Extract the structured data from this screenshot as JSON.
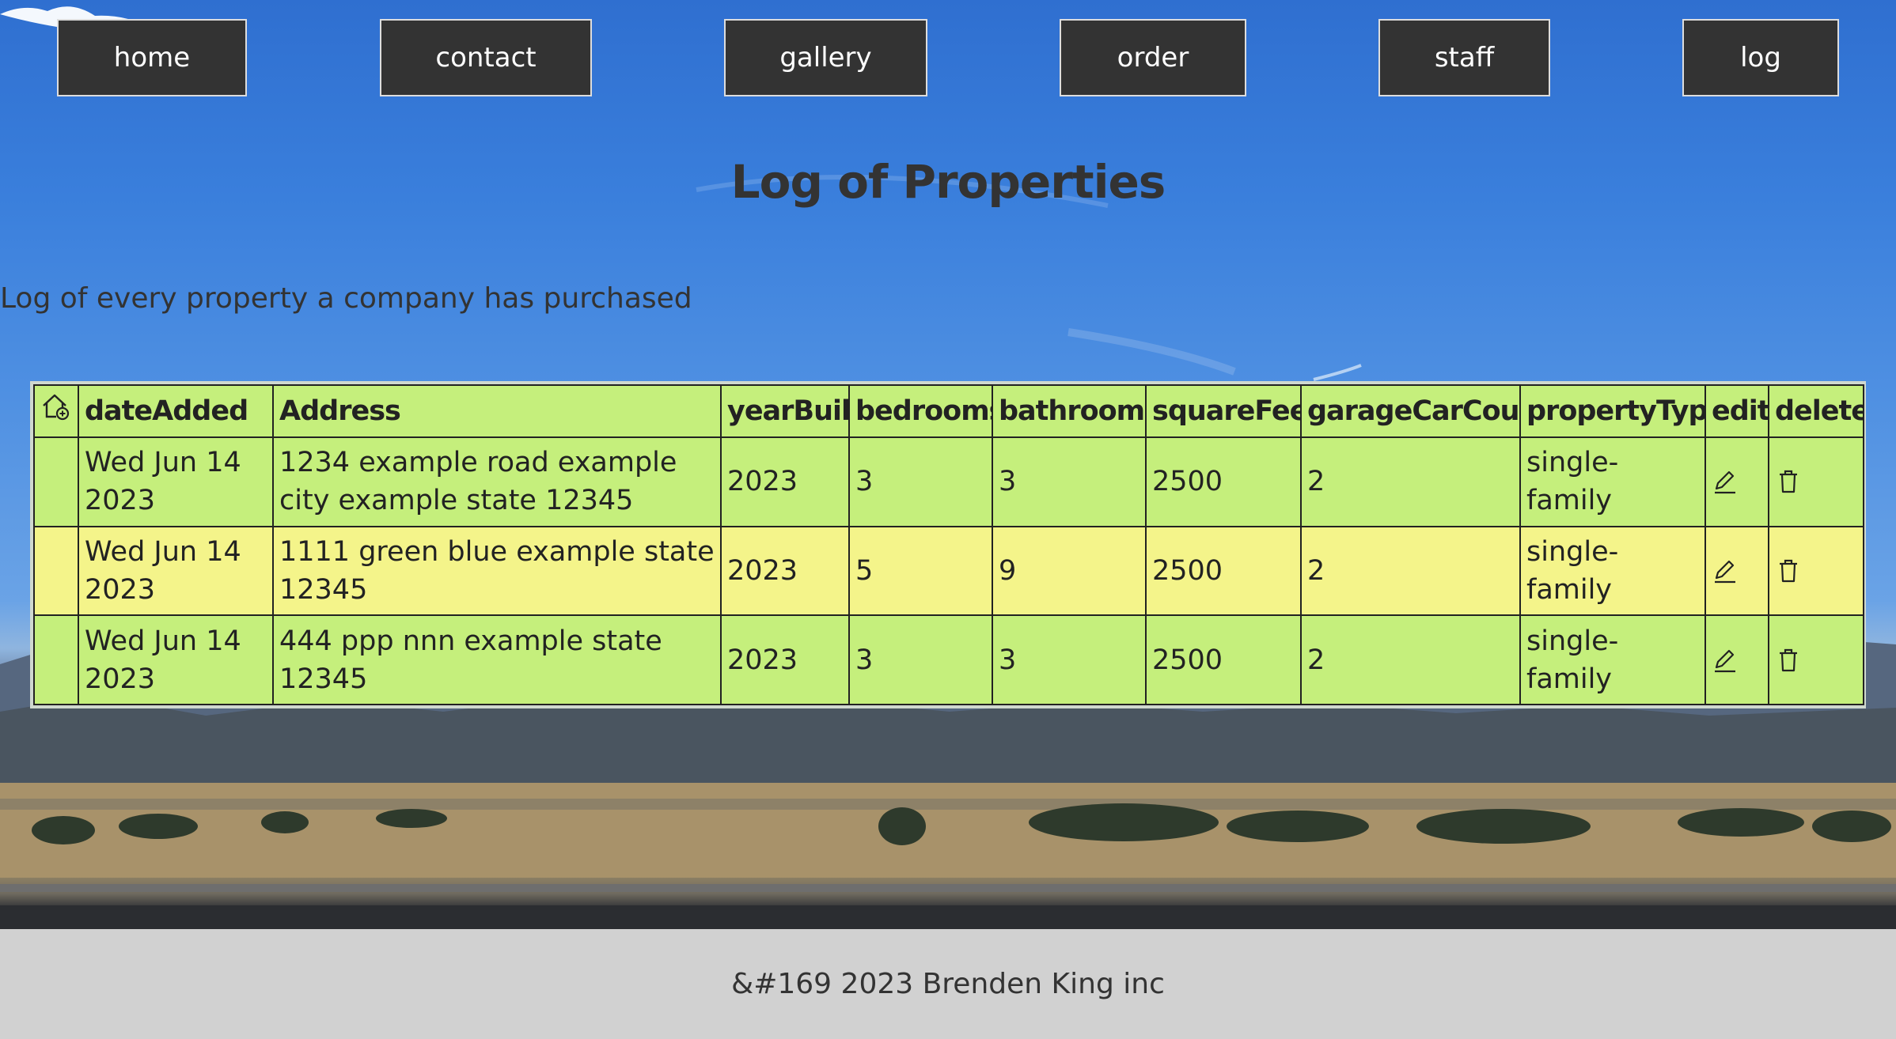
{
  "nav": {
    "items": [
      {
        "label": "home"
      },
      {
        "label": "contact"
      },
      {
        "label": "gallery"
      },
      {
        "label": "order"
      },
      {
        "label": "staff"
      },
      {
        "label": "log"
      }
    ]
  },
  "page": {
    "title": "Log of Properties",
    "subtitle": "Log of every property a company has purchased"
  },
  "table": {
    "header_icon": "house-add-icon",
    "columns": [
      "dateAdded",
      "Address",
      "yearBuilt",
      "bedrooms",
      "bathrooms",
      "squareFeet",
      "garageCarCount",
      "propertyType",
      "edit",
      "delete"
    ],
    "rows": [
      {
        "dateAdded": "Wed Jun 14 2023",
        "address": "1234 example road example city example state 12345",
        "yearBuilt": "2023",
        "bedrooms": "3",
        "bathrooms": "3",
        "squareFeet": "2500",
        "garageCarCount": "2",
        "propertyType": "single-family",
        "edit_icon": "pencil-icon",
        "delete_icon": "trash-icon",
        "row_color": "#c5ef7c"
      },
      {
        "dateAdded": "Wed Jun 14 2023",
        "address": "1111 green blue example state 12345",
        "yearBuilt": "2023",
        "bedrooms": "5",
        "bathrooms": "9",
        "squareFeet": "2500",
        "garageCarCount": "2",
        "propertyType": "single-family",
        "edit_icon": "pencil-icon",
        "delete_icon": "trash-icon",
        "row_color": "#f4f48a"
      },
      {
        "dateAdded": "Wed Jun 14 2023",
        "address": "444 ppp nnn example state 12345",
        "yearBuilt": "2023",
        "bedrooms": "3",
        "bathrooms": "3",
        "squareFeet": "2500",
        "garageCarCount": "2",
        "propertyType": "single-family",
        "edit_icon": "pencil-icon",
        "delete_icon": "trash-icon",
        "row_color": "#c5ef7c"
      }
    ]
  },
  "footer": {
    "text": "&#169 2023 Brenden King inc"
  },
  "colors": {
    "nav_bg": "#333333",
    "row_green": "#c5ef7c",
    "row_yellow": "#f4f48a",
    "footer_bg": "#d1d1d1",
    "text": "#333333"
  }
}
